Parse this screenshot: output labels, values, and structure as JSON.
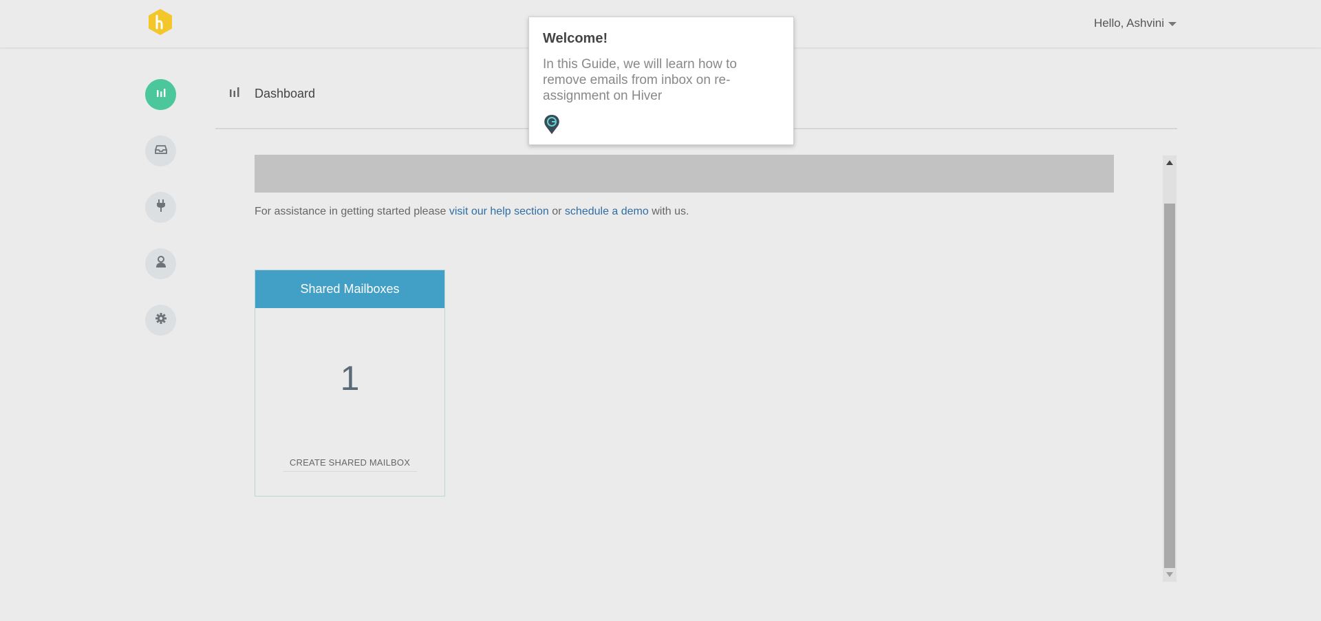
{
  "header": {
    "logo_icon": "hiver-hexagon-logo",
    "greeting": "Hello, Ashvini"
  },
  "sidenav": {
    "items": [
      {
        "icon": "analytics-icon",
        "active": true
      },
      {
        "icon": "inbox-icon",
        "active": false
      },
      {
        "icon": "plug-icon",
        "active": false
      },
      {
        "icon": "user-icon",
        "active": false
      },
      {
        "icon": "gear-icon",
        "active": false
      }
    ]
  },
  "page": {
    "title": "Dashboard",
    "title_icon": "analytics-icon"
  },
  "assist": {
    "prefix": "For assistance in getting started please ",
    "help_link": "visit our help section",
    "middle": " or ",
    "demo_link": "schedule a demo",
    "suffix": " with us."
  },
  "card": {
    "title": "Shared Mailboxes",
    "count": "1",
    "action": "CREATE SHARED MAILBOX"
  },
  "guide_popup": {
    "title": "Welcome!",
    "body": "In this Guide, we will learn how to remove emails from inbox on re-assignment on Hiver",
    "marker_icon": "guide-marker-icon"
  },
  "colors": {
    "accent_green": "#4cc79c",
    "card_header": "#429fc6",
    "link": "#2f6da3",
    "logo_yellow": "#f3c629"
  }
}
